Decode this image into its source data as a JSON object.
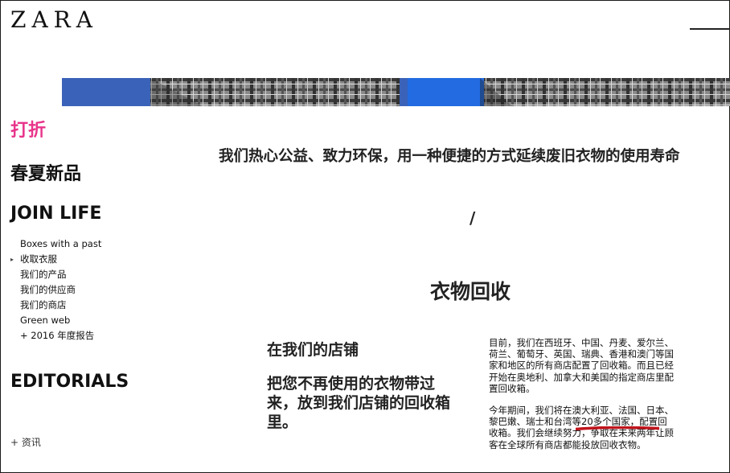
{
  "header": {
    "logo": "ZARA",
    "menu_icon": "hamburger-line-icon"
  },
  "banner": {
    "image": "fabric-plaid-banner",
    "colors": [
      "#2a6fd8",
      "#6a6a6a"
    ]
  },
  "sidebar": {
    "sale": "打折",
    "new_in": "春夏新品",
    "join_life": "JOIN LIFE",
    "items": [
      {
        "label": "Boxes with a past"
      },
      {
        "label": "收取衣服"
      },
      {
        "label": "我们的产品"
      },
      {
        "label": "我们的供应商"
      },
      {
        "label": "我们的商店"
      },
      {
        "label": "Green web"
      },
      {
        "label": "+ 2016 年度报告"
      }
    ],
    "editorials": "EDITORIALS",
    "info": "+ 资讯"
  },
  "content": {
    "tagline": "我们热心公益、致力环保，用一种便捷的方式延续废旧衣物的使用寿命",
    "separator": "/",
    "title": "衣物回收",
    "store_title": "在我们的店铺",
    "store_desc": "把您不再使用的衣物带过来，放到我们店铺的回收箱里。",
    "para1": "目前，我们在西班牙、中国、丹麦、爱尔兰、荷兰、葡萄牙、英国、瑞典、香港和澳门等国家和地区的所有商店配置了回收箱。而且已经开始在奥地利、加拿大和美国的指定商店里配置回收箱。",
    "para2": "今年期间，我们将在澳大利亚、法国、日本、黎巴嫩、瑞士和台湾等20多个国家，配置回收箱。我们会继续努力，争取在未来两年让顾客在全球所有商店都能投放回收衣物。"
  },
  "colors": {
    "sale_pink": "#e8348a",
    "annotation_red": "#c0141c"
  }
}
